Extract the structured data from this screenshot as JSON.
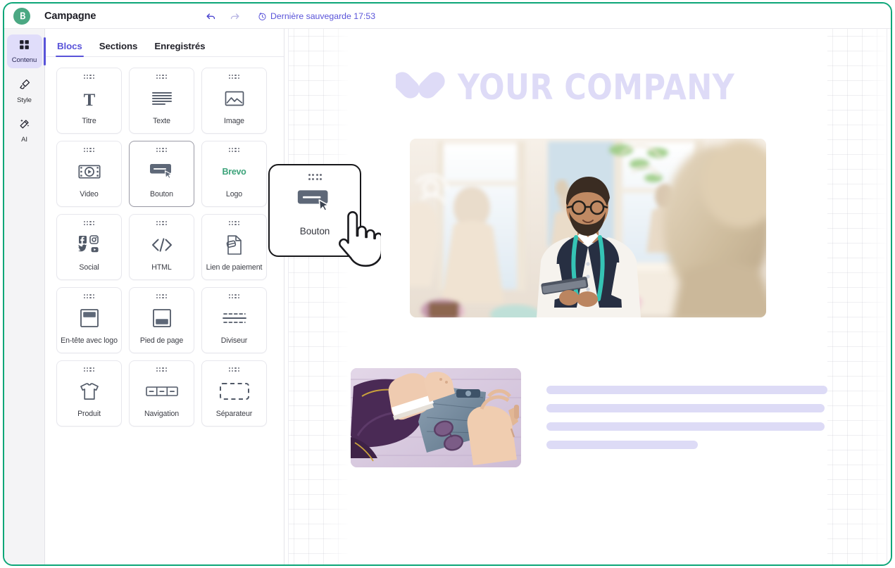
{
  "app": {
    "brand_icon": "brevo-logo-icon",
    "title": "Campagne",
    "undo_icon": "undo-arrow-icon",
    "redo_icon": "redo-arrow-icon",
    "clock_icon": "clock-icon",
    "save_status": "Dernière sauvegarde 17:53",
    "accent_purple": "#5953d9",
    "brand_green": "#0ca678",
    "placeholder_lavender": "#dddbf6"
  },
  "rail": {
    "items": [
      {
        "label": "Contenu",
        "icon": "grid-squares-icon",
        "active": true
      },
      {
        "label": "Style",
        "icon": "paint-brush-icon",
        "active": false
      },
      {
        "label": "AI",
        "icon": "magic-wand-icon",
        "active": false
      }
    ]
  },
  "panel": {
    "tabs": [
      {
        "label": "Blocs",
        "active": true
      },
      {
        "label": "Sections",
        "active": false
      },
      {
        "label": "Enregistrés",
        "active": false
      }
    ],
    "blocks": [
      {
        "label": "Titre",
        "icon": "serif-t-icon",
        "selected": false
      },
      {
        "label": "Texte",
        "icon": "text-lines-icon",
        "selected": false
      },
      {
        "label": "Image",
        "icon": "picture-icon",
        "selected": false
      },
      {
        "label": "Video",
        "icon": "film-play-icon",
        "selected": false
      },
      {
        "label": "Bouton",
        "icon": "button-cursor-icon",
        "selected": true
      },
      {
        "label": "Logo",
        "icon": "brevo-wordmark-icon",
        "selected": false,
        "word": "Brevo"
      },
      {
        "label": "Social",
        "icon": "social-networks-icon",
        "selected": false
      },
      {
        "label": "HTML",
        "icon": "code-brackets-icon",
        "selected": false
      },
      {
        "label": "Lien de paiement",
        "icon": "payment-document-icon",
        "selected": false
      },
      {
        "label": "En-tête avec logo",
        "icon": "header-block-icon",
        "selected": false
      },
      {
        "label": "Pied de page",
        "icon": "footer-block-icon",
        "selected": false
      },
      {
        "label": "Diviseur",
        "icon": "divider-icon",
        "selected": false
      },
      {
        "label": "Produit",
        "icon": "tshirt-icon",
        "selected": false
      },
      {
        "label": "Navigation",
        "icon": "nav-bar-icon",
        "selected": false
      },
      {
        "label": "Séparateur",
        "icon": "dashed-spacer-icon",
        "selected": false
      }
    ]
  },
  "drag": {
    "label": "Bouton",
    "icon": "button-cursor-icon",
    "cursor_icon": "pointing-hand-cursor-icon"
  },
  "canvas": {
    "logo_text": "YOUR COMPANY",
    "logo_mark_icon": "two-rounded-diamonds-logo-icon",
    "hero_image_alt": "tailor-in-bridal-boutique-photo",
    "product_image_alt": "fashion-flatlay-sweater-sneaker-jeans-photo",
    "placeholder_lines": [
      {
        "width_pct": 100
      },
      {
        "width_pct": 99
      },
      {
        "width_pct": 99
      },
      {
        "width_pct": 54
      }
    ]
  }
}
